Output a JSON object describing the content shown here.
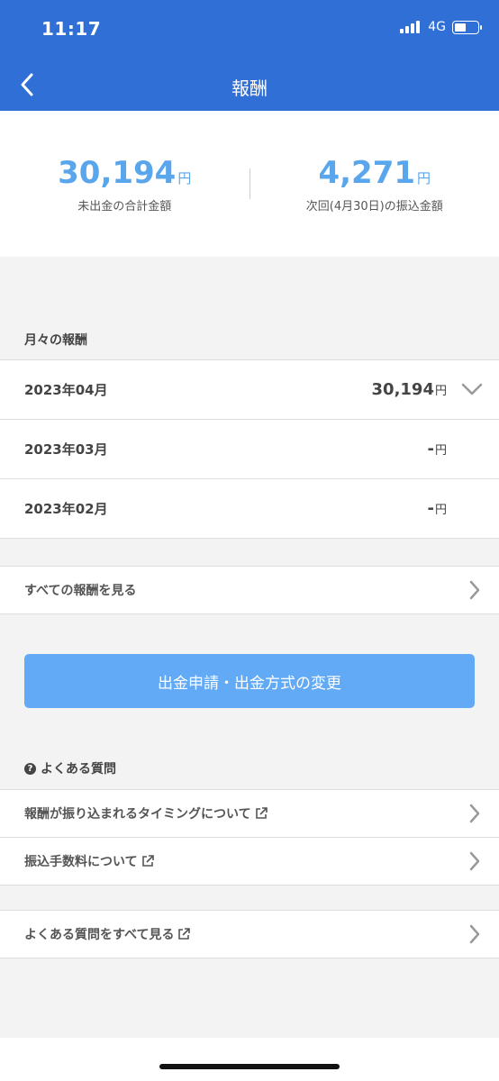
{
  "status_bar": {
    "time": "11:17",
    "network": "4G"
  },
  "nav": {
    "title": "報酬"
  },
  "summary": {
    "unpaid": {
      "amount": "30,194",
      "unit": "円",
      "label": "未出金の合計金額"
    },
    "next": {
      "amount": "4,271",
      "unit": "円",
      "label": "次回(4月30日)の振込金額"
    }
  },
  "monthly": {
    "heading": "月々の報酬",
    "rows": [
      {
        "month": "2023年04月",
        "amount": "30,194",
        "unit": "円"
      },
      {
        "month": "2023年03月",
        "amount": "-",
        "unit": "円"
      },
      {
        "month": "2023年02月",
        "amount": "-",
        "unit": "円"
      }
    ]
  },
  "all_rewards": {
    "label": "すべての報酬を見る"
  },
  "action_button": {
    "label": "出金申請・出金方式の変更"
  },
  "faq": {
    "heading": "よくある質問",
    "question_icon": "?",
    "items": [
      {
        "label": "報酬が振り込まれるタイミングについて"
      },
      {
        "label": "振込手数料について"
      }
    ],
    "all": {
      "label": "よくある質問をすべて見る"
    }
  },
  "colors": {
    "header": "#2f6fd6",
    "accent": "#5aa6ec",
    "button": "#62aaf5"
  }
}
